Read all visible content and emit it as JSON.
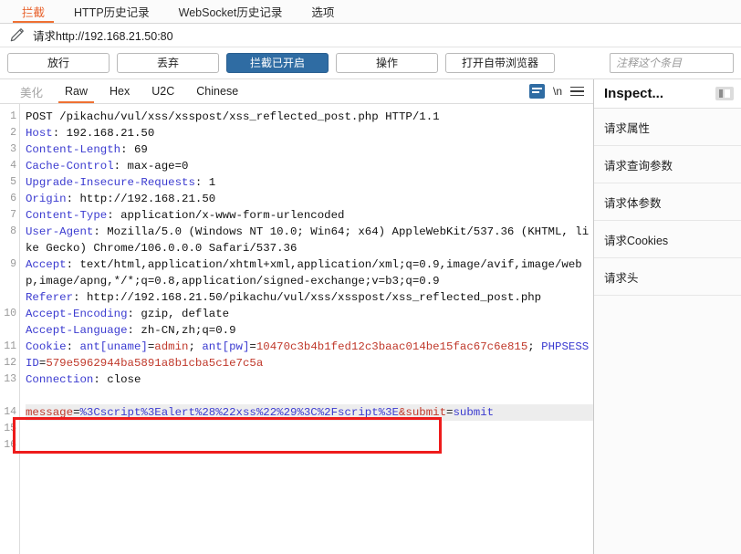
{
  "tabs": [
    {
      "label": "拦截",
      "active": true
    },
    {
      "label": "HTTP历史记录",
      "active": false
    },
    {
      "label": "WebSocket历史记录",
      "active": false
    },
    {
      "label": "选项",
      "active": false
    }
  ],
  "url_row": {
    "edit_icon": "pencil-icon",
    "text": "请求http://192.168.21.50:80"
  },
  "actions": {
    "forward": "放行",
    "drop": "丢弃",
    "intercept_toggle": "拦截已开启",
    "action": "操作",
    "open_browser": "打开自带浏览器",
    "comment_placeholder": "注释这个条目",
    "comment_value": ""
  },
  "editor": {
    "tabs": [
      {
        "label": "美化",
        "state": "disabled"
      },
      {
        "label": "Raw",
        "state": "active"
      },
      {
        "label": "Hex",
        "state": "normal"
      },
      {
        "label": "U2C",
        "state": "normal"
      },
      {
        "label": "Chinese",
        "state": "normal"
      }
    ],
    "tools": {
      "wrap_icon": "word-wrap-icon",
      "newline_label": "\\n",
      "menu_icon": "hamburger-menu-icon"
    },
    "line_numbers": [
      "1",
      "2",
      "3",
      "4",
      "5",
      "6",
      "7",
      "8",
      "",
      "9",
      "",
      "",
      "10",
      "",
      "11",
      "12",
      "13",
      "",
      "14",
      "15",
      "16"
    ],
    "request": {
      "request_line": {
        "method": "POST",
        "path": "/pikachu/vul/xss/xsspost/xss_reflected_post.php",
        "version": "HTTP/1.1"
      },
      "headers": [
        {
          "name": "Host",
          "value": "192.168.21.50"
        },
        {
          "name": "Content-Length",
          "value": "69"
        },
        {
          "name": "Cache-Control",
          "value": "max-age=0"
        },
        {
          "name": "Upgrade-Insecure-Requests",
          "value": "1"
        },
        {
          "name": "Origin",
          "value": "http://192.168.21.50"
        },
        {
          "name": "Content-Type",
          "value": "application/x-www-form-urlencoded"
        },
        {
          "name": "User-Agent",
          "value": "Mozilla/5.0 (Windows NT 10.0; Win64; x64) AppleWebKit/537.36 (KHTML, like Gecko) Chrome/106.0.0.0 Safari/537.36"
        },
        {
          "name": "Accept",
          "value": "text/html,application/xhtml+xml,application/xml;q=0.9,image/avif,image/webp,image/apng,*/*;q=0.8,application/signed-exchange;v=b3;q=0.9"
        },
        {
          "name": "Referer",
          "value": "http://192.168.21.50/pikachu/vul/xss/xsspost/xss_reflected_post.php"
        },
        {
          "name": "Accept-Encoding",
          "value": "gzip, deflate"
        },
        {
          "name": "Accept-Language",
          "value": "zh-CN,zh;q=0.9"
        }
      ],
      "cookie_header_name": "Cookie",
      "cookies": [
        {
          "name": "ant[uname]",
          "value": "admin"
        },
        {
          "name": "ant[pw]",
          "value": "10470c3b4b1fed12c3baac014be15fac67c6e815"
        },
        {
          "name": "PHPSESSID",
          "value": "579e5962944ba5891a8b1cba5c1e7c5a"
        }
      ],
      "connection": {
        "name": "Connection",
        "value": "close"
      },
      "body_params": [
        {
          "name": "message",
          "value": "%3Cscript%3Ealert%28%22xss%22%29%3C%2Fscript%3E"
        },
        {
          "name": "submit",
          "value": "submit"
        }
      ]
    }
  },
  "inspect": {
    "title": "Inspect...",
    "toggle_icon": "panel-layout-icon",
    "items": [
      {
        "label": "请求属性"
      },
      {
        "label": "请求查询参数"
      },
      {
        "label": "请求体参数"
      },
      {
        "label": "请求Cookies"
      },
      {
        "label": "请求头"
      }
    ]
  },
  "annotation": {
    "type": "red-rectangle-highlight",
    "color": "#ee1c1c"
  },
  "colors": {
    "accent_orange": "#ef7133",
    "primary_blue": "#2f6ca3",
    "header_name": "#3b3bd0",
    "param_name": "#c0392b",
    "annotation_red": "#ee1c1c"
  }
}
